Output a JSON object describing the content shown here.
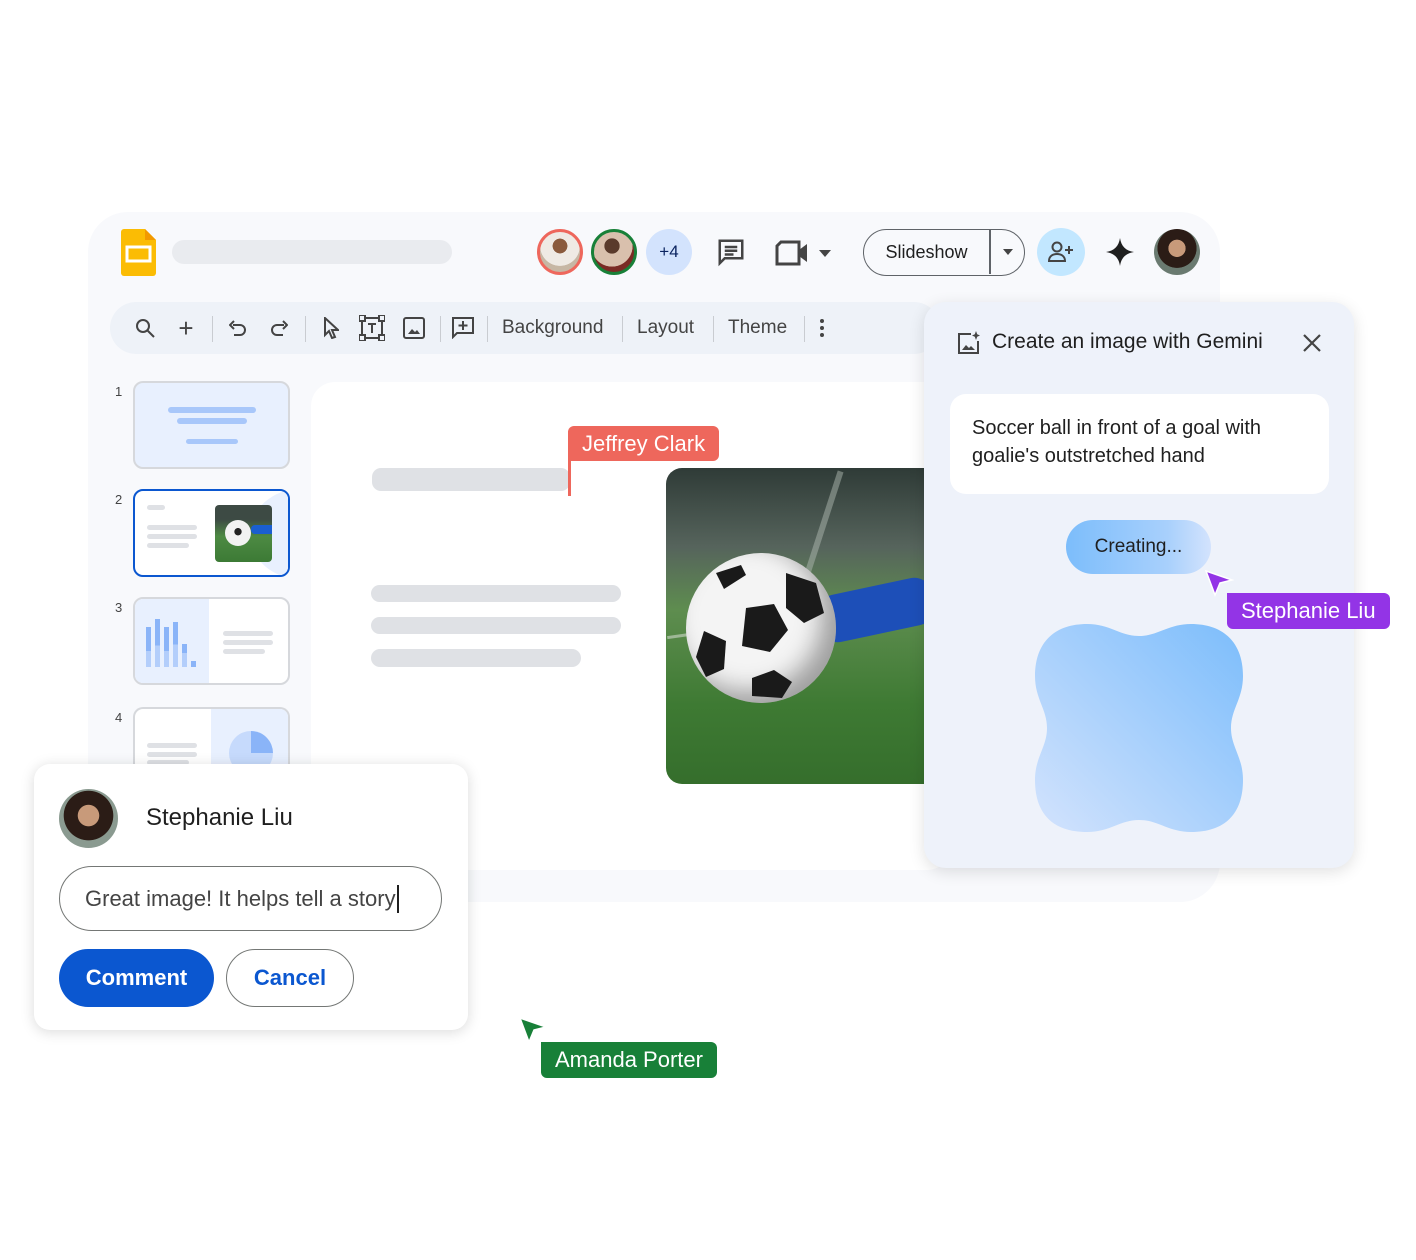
{
  "header": {
    "collaborators_extra": "+4",
    "slideshow_label": "Slideshow",
    "app_icon": "slides-logo-icon"
  },
  "toolbar": {
    "background_label": "Background",
    "layout_label": "Layout",
    "theme_label": "Theme"
  },
  "slides": [
    {
      "number": "1"
    },
    {
      "number": "2",
      "selected": true
    },
    {
      "number": "3"
    },
    {
      "number": "4"
    }
  ],
  "cursors": {
    "jeffrey": {
      "name": "Jeffrey Clark",
      "color": "#ee675c"
    },
    "stephanie": {
      "name": "Stephanie Liu",
      "color": "#9334e6"
    },
    "amanda": {
      "name": "Amanda Porter",
      "color": "#188038"
    }
  },
  "gemini": {
    "title": "Create an image with Gemini",
    "prompt": "Soccer ball in front of a goal with goalie's outstretched hand",
    "status": "Creating..."
  },
  "comment": {
    "author": "Stephanie Liu",
    "input_value": "Great image! It helps tell a story",
    "submit_label": "Comment",
    "cancel_label": "Cancel",
    "accent": "#0b57d0"
  }
}
